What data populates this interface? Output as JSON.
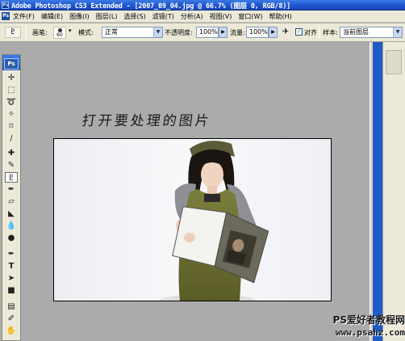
{
  "window": {
    "title": "Adobe Photoshop CS3 Extended - [2007_09_04.jpg @ 66.7% (图层 0, RGB/8)]"
  },
  "menu": {
    "items": [
      "文件(F)",
      "编辑(E)",
      "图像(I)",
      "图层(L)",
      "选择(S)",
      "滤镜(T)",
      "分析(A)",
      "视图(V)",
      "窗口(W)",
      "帮助(H)"
    ]
  },
  "options": {
    "brush_label": "画笔:",
    "brush_size": "60",
    "mode_label": "模式:",
    "mode_value": "正常",
    "opacity_label": "不透明度:",
    "opacity_value": "100%",
    "flow_label": "流量:",
    "flow_value": "100%",
    "aligned_label": "对齐",
    "aligned_checked": true,
    "sample_label": "样本:",
    "sample_value": "当前图层"
  },
  "toolbox": {
    "logo": "Ps",
    "tools": [
      "move-icon",
      "marquee-icon",
      "lasso-icon",
      "magic-wand-icon",
      "crop-icon",
      "slice-icon",
      "healing-brush-icon",
      "brush-icon",
      "clone-stamp-icon",
      "history-brush-icon",
      "eraser-icon",
      "paint-bucket-icon",
      "blur-icon",
      "dodge-icon",
      "pen-icon",
      "type-icon",
      "path-select-icon",
      "rectangle-shape-icon",
      "notes-icon",
      "eyedropper-icon",
      "hand-icon"
    ],
    "active_tool": "clone-stamp-icon"
  },
  "document": {
    "caption": "打开要处理的图片"
  },
  "watermark": {
    "line1": "PS爱好者教程网",
    "line2": "www.psahz.com"
  }
}
